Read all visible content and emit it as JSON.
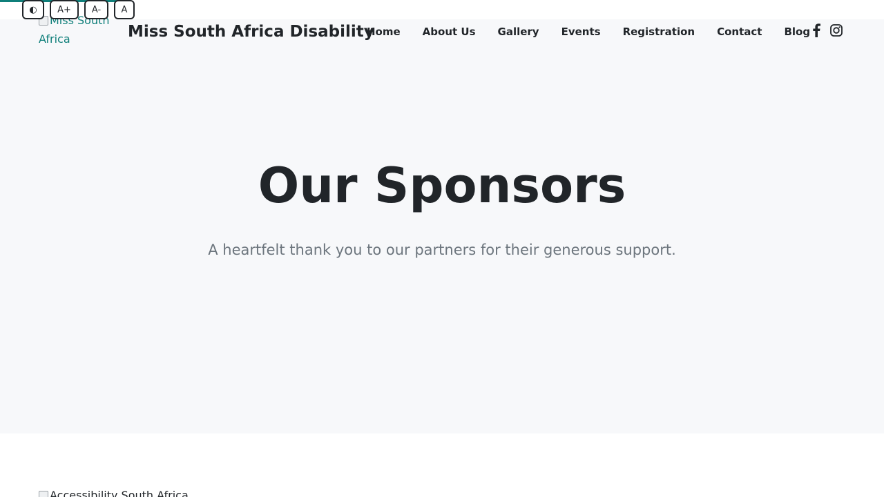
{
  "a11y": {
    "contrast_label": "◐",
    "increase_label": "A+",
    "decrease_label": "A-",
    "reset_label": "A"
  },
  "header": {
    "logo_alt": "Miss South Africa",
    "site_title": "Miss South Africa Disability",
    "nav": [
      {
        "label": "Home"
      },
      {
        "label": "About Us"
      },
      {
        "label": "Gallery"
      },
      {
        "label": "Events"
      },
      {
        "label": "Registration"
      },
      {
        "label": "Contact"
      },
      {
        "label": "Blog"
      }
    ],
    "socials": [
      "facebook-icon",
      "instagram-icon"
    ]
  },
  "hero": {
    "title": "Our Sponsors",
    "subtitle": "A heartfelt thank you to our partners for their generous support."
  },
  "sponsors": {
    "first_image_alt": "Accessibility South Africa"
  },
  "colors": {
    "accent": "#0f7f7a",
    "text": "#212529",
    "muted": "#6c757d",
    "hero_bg": "#f7f8fa"
  }
}
